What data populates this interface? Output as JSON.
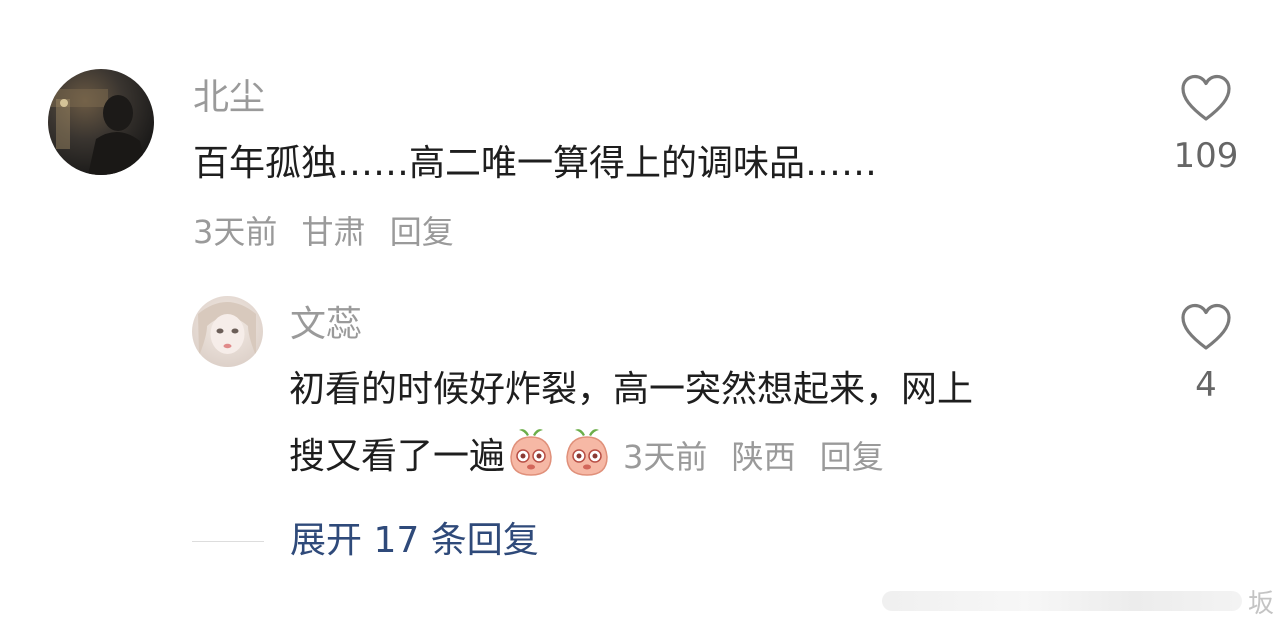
{
  "comment": {
    "username": "北尘",
    "text": "百年孤独……高二唯一算得上的调味品……",
    "time": "3天前",
    "location": "甘肃",
    "reply_label": "回复",
    "likes": "109",
    "avatar_icon": "user-photo-avatar"
  },
  "reply": {
    "username": "文蕊",
    "text_line1": "初看的时候好炸裂，高一突然想起来，网上",
    "text_line2": "搜又看了一遍",
    "emojis": [
      "peach-face-emoji",
      "peach-face-emoji"
    ],
    "time": "3天前",
    "location": "陕西",
    "reply_label": "回复",
    "likes": "4",
    "avatar_icon": "user-photo-avatar"
  },
  "expand": {
    "label": "展开 17 条回复"
  },
  "watermark": {
    "text": "坂"
  },
  "colors": {
    "username": "#9a9a9a",
    "text": "#1e1e1e",
    "meta": "#9a9a9a",
    "link": "#2f4a7a",
    "heart": "#7a7a7a"
  }
}
